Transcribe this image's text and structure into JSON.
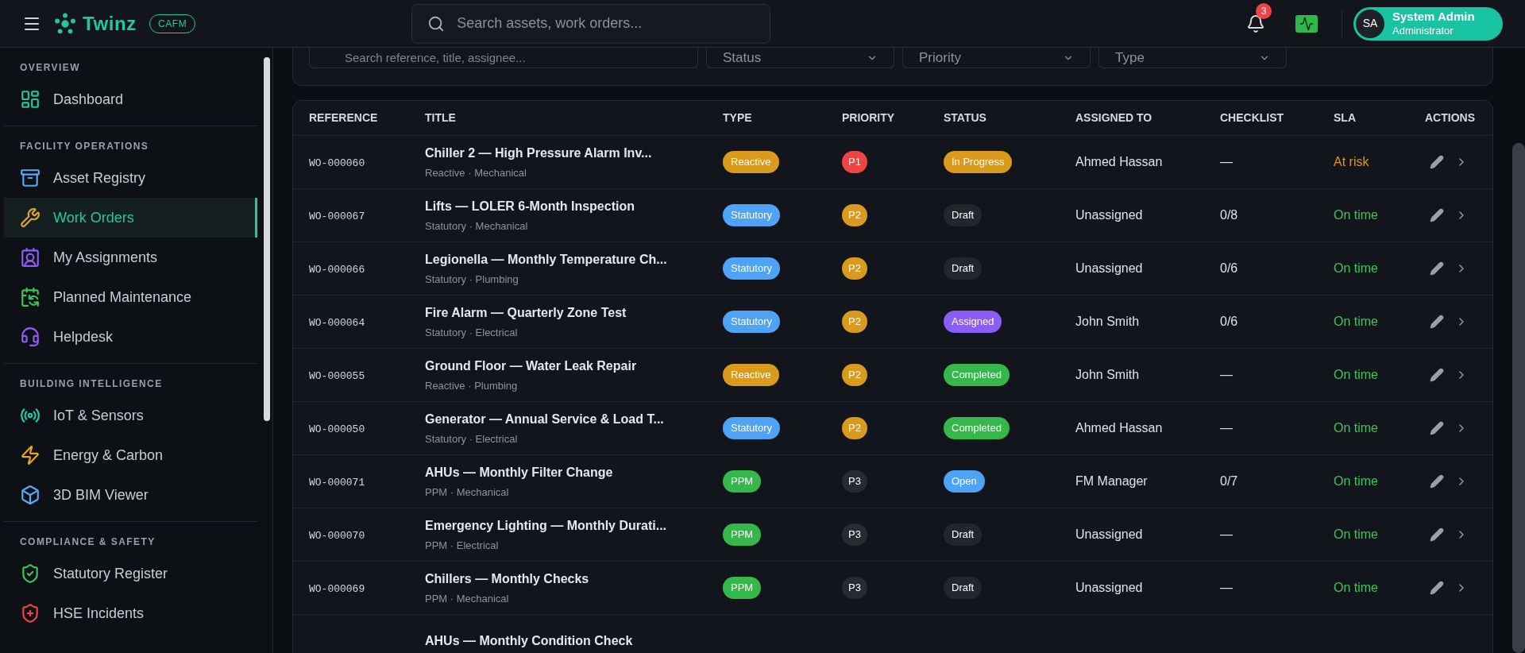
{
  "header": {
    "brand": "Twinz",
    "badge": "CAFM",
    "search": {
      "placeholder": "Search assets, work orders..."
    },
    "notifications": {
      "count": "3"
    },
    "user": {
      "initials": "SA",
      "name": "System Admin",
      "role": "Administrator"
    }
  },
  "sidebar": {
    "sections": [
      {
        "title": "OVERVIEW",
        "items": [
          {
            "label": "Dashboard",
            "selected": false
          }
        ]
      },
      {
        "title": "FACILITY OPERATIONS",
        "items": [
          {
            "label": "Asset Registry",
            "selected": false
          },
          {
            "label": "Work Orders",
            "selected": true
          },
          {
            "label": "My Assignments",
            "selected": false
          },
          {
            "label": "Planned Maintenance",
            "selected": false
          },
          {
            "label": "Helpdesk",
            "selected": false
          }
        ]
      },
      {
        "title": "BUILDING INTELLIGENCE",
        "items": [
          {
            "label": "IoT & Sensors",
            "selected": false
          },
          {
            "label": "Energy & Carbon",
            "selected": false
          },
          {
            "label": "3D BIM Viewer",
            "selected": false
          }
        ]
      },
      {
        "title": "COMPLIANCE & SAFETY",
        "items": [
          {
            "label": "Statutory Register",
            "selected": false
          },
          {
            "label": "HSE Incidents",
            "selected": false
          }
        ]
      }
    ]
  },
  "filters": {
    "search": {
      "placeholder": "Search reference, title, assignee..."
    },
    "dropdowns": [
      "Status",
      "Priority",
      "Type"
    ]
  },
  "table": {
    "columns": [
      "REFERENCE",
      "TITLE",
      "TYPE",
      "PRIORITY",
      "STATUS",
      "ASSIGNED TO",
      "CHECKLIST",
      "SLA",
      "ACTIONS"
    ],
    "rows": [
      {
        "reference": "WO-000060",
        "title": "Chiller 2 — High Pressure Alarm Inv...",
        "subtitle": "Reactive · Mechanical",
        "type": {
          "label": "Reactive",
          "color": "#d99a1e"
        },
        "priority": {
          "label": "P1",
          "color": "#ef4444"
        },
        "status": {
          "label": "In Progress",
          "color": "#d99a1e"
        },
        "assigned_to": "Ahmed Hassan",
        "checklist": "—",
        "sla": {
          "label": "At risk",
          "color": "#d99a1e"
        }
      },
      {
        "reference": "WO-000067",
        "title": "Lifts — LOLER 6-Month Inspection",
        "subtitle": "Statutory · Mechanical",
        "type": {
          "label": "Statutory",
          "color": "#4ea3f5"
        },
        "priority": {
          "label": "P2",
          "color": "#d99a1e"
        },
        "status": {
          "label": "Draft",
          "color": "#22262d"
        },
        "assigned_to": "Unassigned",
        "checklist": "0/8",
        "sla": {
          "label": "On time",
          "color": "#3fc35a"
        }
      },
      {
        "reference": "WO-000066",
        "title": "Legionella — Monthly Temperature Ch...",
        "subtitle": "Statutory · Plumbing",
        "type": {
          "label": "Statutory",
          "color": "#4ea3f5"
        },
        "priority": {
          "label": "P2",
          "color": "#d99a1e"
        },
        "status": {
          "label": "Draft",
          "color": "#22262d"
        },
        "assigned_to": "Unassigned",
        "checklist": "0/6",
        "sla": {
          "label": "On time",
          "color": "#3fc35a"
        }
      },
      {
        "reference": "WO-000064",
        "title": "Fire Alarm — Quarterly Zone Test",
        "subtitle": "Statutory · Electrical",
        "type": {
          "label": "Statutory",
          "color": "#4ea3f5"
        },
        "priority": {
          "label": "P2",
          "color": "#d99a1e"
        },
        "status": {
          "label": "Assigned",
          "color": "#8b5cf6"
        },
        "assigned_to": "John Smith",
        "checklist": "0/6",
        "sla": {
          "label": "On time",
          "color": "#3fc35a"
        }
      },
      {
        "reference": "WO-000055",
        "title": "Ground Floor — Water Leak Repair",
        "subtitle": "Reactive · Plumbing",
        "type": {
          "label": "Reactive",
          "color": "#d99a1e"
        },
        "priority": {
          "label": "P2",
          "color": "#d99a1e"
        },
        "status": {
          "label": "Completed",
          "color": "#34b84a"
        },
        "assigned_to": "John Smith",
        "checklist": "—",
        "sla": {
          "label": "On time",
          "color": "#3fc35a"
        }
      },
      {
        "reference": "WO-000050",
        "title": "Generator — Annual Service & Load T...",
        "subtitle": "Statutory · Electrical",
        "type": {
          "label": "Statutory",
          "color": "#4ea3f5"
        },
        "priority": {
          "label": "P2",
          "color": "#d99a1e"
        },
        "status": {
          "label": "Completed",
          "color": "#34b84a"
        },
        "assigned_to": "Ahmed Hassan",
        "checklist": "—",
        "sla": {
          "label": "On time",
          "color": "#3fc35a"
        }
      },
      {
        "reference": "WO-000071",
        "title": "AHUs — Monthly Filter Change",
        "subtitle": "PPM · Mechanical",
        "type": {
          "label": "PPM",
          "color": "#34b84a"
        },
        "priority": {
          "label": "P3",
          "color": "#262a31"
        },
        "status": {
          "label": "Open",
          "color": "#4ea3f5"
        },
        "assigned_to": "FM Manager",
        "checklist": "0/7",
        "sla": {
          "label": "On time",
          "color": "#3fc35a"
        }
      },
      {
        "reference": "WO-000070",
        "title": "Emergency Lighting — Monthly Durati...",
        "subtitle": "PPM · Electrical",
        "type": {
          "label": "PPM",
          "color": "#34b84a"
        },
        "priority": {
          "label": "P3",
          "color": "#262a31"
        },
        "status": {
          "label": "Draft",
          "color": "#22262d"
        },
        "assigned_to": "Unassigned",
        "checklist": "—",
        "sla": {
          "label": "On time",
          "color": "#3fc35a"
        }
      },
      {
        "reference": "WO-000069",
        "title": "Chillers — Monthly Checks",
        "subtitle": "PPM · Mechanical",
        "type": {
          "label": "PPM",
          "color": "#34b84a"
        },
        "priority": {
          "label": "P3",
          "color": "#262a31"
        },
        "status": {
          "label": "Draft",
          "color": "#22262d"
        },
        "assigned_to": "Unassigned",
        "checklist": "—",
        "sla": {
          "label": "On time",
          "color": "#3fc35a"
        }
      },
      {
        "title": "AHUs — Monthly Condition Check"
      }
    ]
  }
}
